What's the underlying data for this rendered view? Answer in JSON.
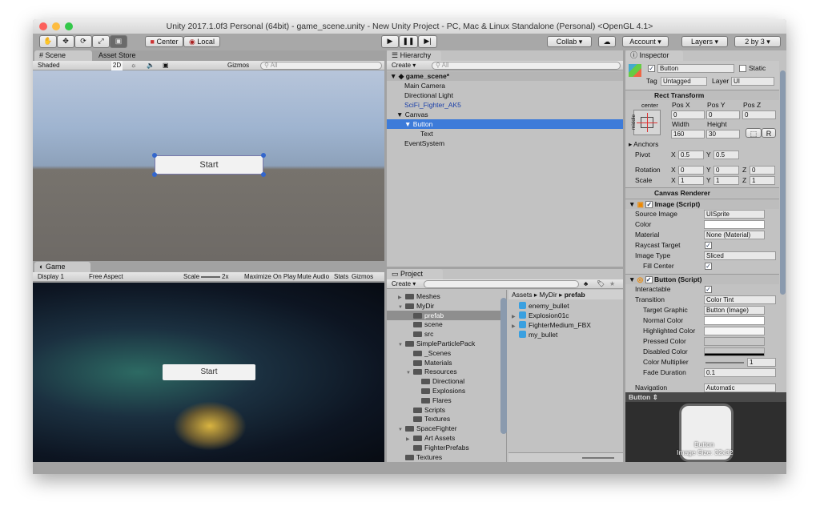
{
  "window": {
    "title": "Unity 2017.1.0f3 Personal (64bit) - game_scene.unity - New Unity Project - PC, Mac & Linux Standalone (Personal) <OpenGL 4.1>"
  },
  "toolbar": {
    "tools": [
      "hand-icon",
      "move-icon",
      "rotate-icon",
      "scale-icon",
      "rect-icon"
    ],
    "center": "Center",
    "local": "Local",
    "collab": "Collab",
    "account": "Account",
    "layers": "Layers",
    "layout": "2 by 3"
  },
  "scene": {
    "tab": "Scene",
    "tab2": "Asset Store",
    "shading": "Shaded",
    "mode2d": "2D",
    "gizmos": "Gizmos",
    "search_placeholder": "All",
    "button_text": "Start"
  },
  "game": {
    "tab": "Game",
    "display": "Display 1",
    "aspect": "Free Aspect",
    "scale_label": "Scale",
    "scale_value": "2x",
    "maximize": "Maximize On Play",
    "mute": "Mute Audio",
    "stats": "Stats",
    "gizmos": "Gizmos",
    "button_text": "Start"
  },
  "hierarchy": {
    "tab": "Hierarchy",
    "create": "Create",
    "search_placeholder": "All",
    "scene": "game_scene*",
    "items": [
      {
        "label": "Main Camera",
        "indent": 1
      },
      {
        "label": "Directional Light",
        "indent": 1
      },
      {
        "label": "SciFi_Fighter_AK5",
        "indent": 1,
        "prefab": true
      },
      {
        "label": "Canvas",
        "indent": 1,
        "expanded": true
      },
      {
        "label": "Button",
        "indent": 2,
        "expanded": true,
        "selected": true
      },
      {
        "label": "Text",
        "indent": 3
      },
      {
        "label": "EventSystem",
        "indent": 1
      }
    ]
  },
  "project": {
    "tab": "Project",
    "create": "Create",
    "tree": [
      {
        "label": "Meshes",
        "indent": 1,
        "arrow": "right"
      },
      {
        "label": "MyDir",
        "indent": 1,
        "arrow": "down"
      },
      {
        "label": "prefab",
        "indent": 2,
        "selected": true
      },
      {
        "label": "scene",
        "indent": 2
      },
      {
        "label": "src",
        "indent": 2
      },
      {
        "label": "SimpleParticlePack",
        "indent": 1,
        "arrow": "down"
      },
      {
        "label": "_Scenes",
        "indent": 2
      },
      {
        "label": "Materials",
        "indent": 2
      },
      {
        "label": "Resources",
        "indent": 2,
        "arrow": "down"
      },
      {
        "label": "Directional",
        "indent": 3
      },
      {
        "label": "Explosions",
        "indent": 3
      },
      {
        "label": "Flares",
        "indent": 3
      },
      {
        "label": "Scripts",
        "indent": 2
      },
      {
        "label": "Textures",
        "indent": 2
      },
      {
        "label": "SpaceFighter",
        "indent": 1,
        "arrow": "down"
      },
      {
        "label": "Art Assets",
        "indent": 2,
        "arrow": "right"
      },
      {
        "label": "FighterPrefabs",
        "indent": 2
      },
      {
        "label": "Textures",
        "indent": 1
      }
    ],
    "breadcrumb": [
      "Assets",
      "MyDir",
      "prefab"
    ],
    "assets": [
      {
        "label": "enemy_bullet"
      },
      {
        "label": "Explosion01c",
        "arrow": true
      },
      {
        "label": "FighterMedium_FBX",
        "arrow": true
      },
      {
        "label": "my_bullet"
      }
    ]
  },
  "inspector": {
    "tab": "Inspector",
    "name": "Button",
    "static": "Static",
    "tag_label": "Tag",
    "tag": "Untagged",
    "layer_label": "Layer",
    "layer": "UI",
    "rect": {
      "title": "Rect Transform",
      "anchor_h": "center",
      "anchor_v": "middle",
      "posx_l": "Pos X",
      "posy_l": "Pos Y",
      "posz_l": "Pos Z",
      "posx": "0",
      "posy": "0",
      "posz": "0",
      "width_l": "Width",
      "height_l": "Height",
      "width": "160",
      "height": "30",
      "r": "R",
      "anchors": "Anchors",
      "pivot": "Pivot",
      "pivot_x": "0.5",
      "pivot_y": "0.5",
      "rotation": "Rotation",
      "rot_x": "0",
      "rot_y": "0",
      "rot_z": "0",
      "scale": "Scale",
      "sc_x": "1",
      "sc_y": "1",
      "sc_z": "1",
      "x": "X",
      "y": "Y",
      "z": "Z"
    },
    "canvas_renderer": "Canvas Renderer",
    "image": {
      "title": "Image (Script)",
      "source_l": "Source Image",
      "source": "UISprite",
      "color_l": "Color",
      "material_l": "Material",
      "material": "None (Material)",
      "raycast_l": "Raycast Target",
      "type_l": "Image Type",
      "type": "Sliced",
      "fill_l": "Fill Center"
    },
    "button": {
      "title": "Button (Script)",
      "interactable_l": "Interactable",
      "transition_l": "Transition",
      "transition": "Color Tint",
      "target_l": "Target Graphic",
      "target": "Button (Image)",
      "normal_l": "Normal Color",
      "highlighted_l": "Highlighted Color",
      "pressed_l": "Pressed Color",
      "disabled_l": "Disabled Color",
      "multiplier_l": "Color Multiplier",
      "multiplier": "1",
      "fade_l": "Fade Duration",
      "fade": "0.1",
      "navigation_l": "Navigation",
      "navigation": "Automatic"
    },
    "preview": {
      "title": "Button",
      "name": "Button",
      "size": "Image Size: 32x32"
    }
  },
  "colors": {
    "selection": "#3d7bd9",
    "panel": "#c2c2c2",
    "sky": "#9fb4d0",
    "ground": "#6e6a66"
  }
}
